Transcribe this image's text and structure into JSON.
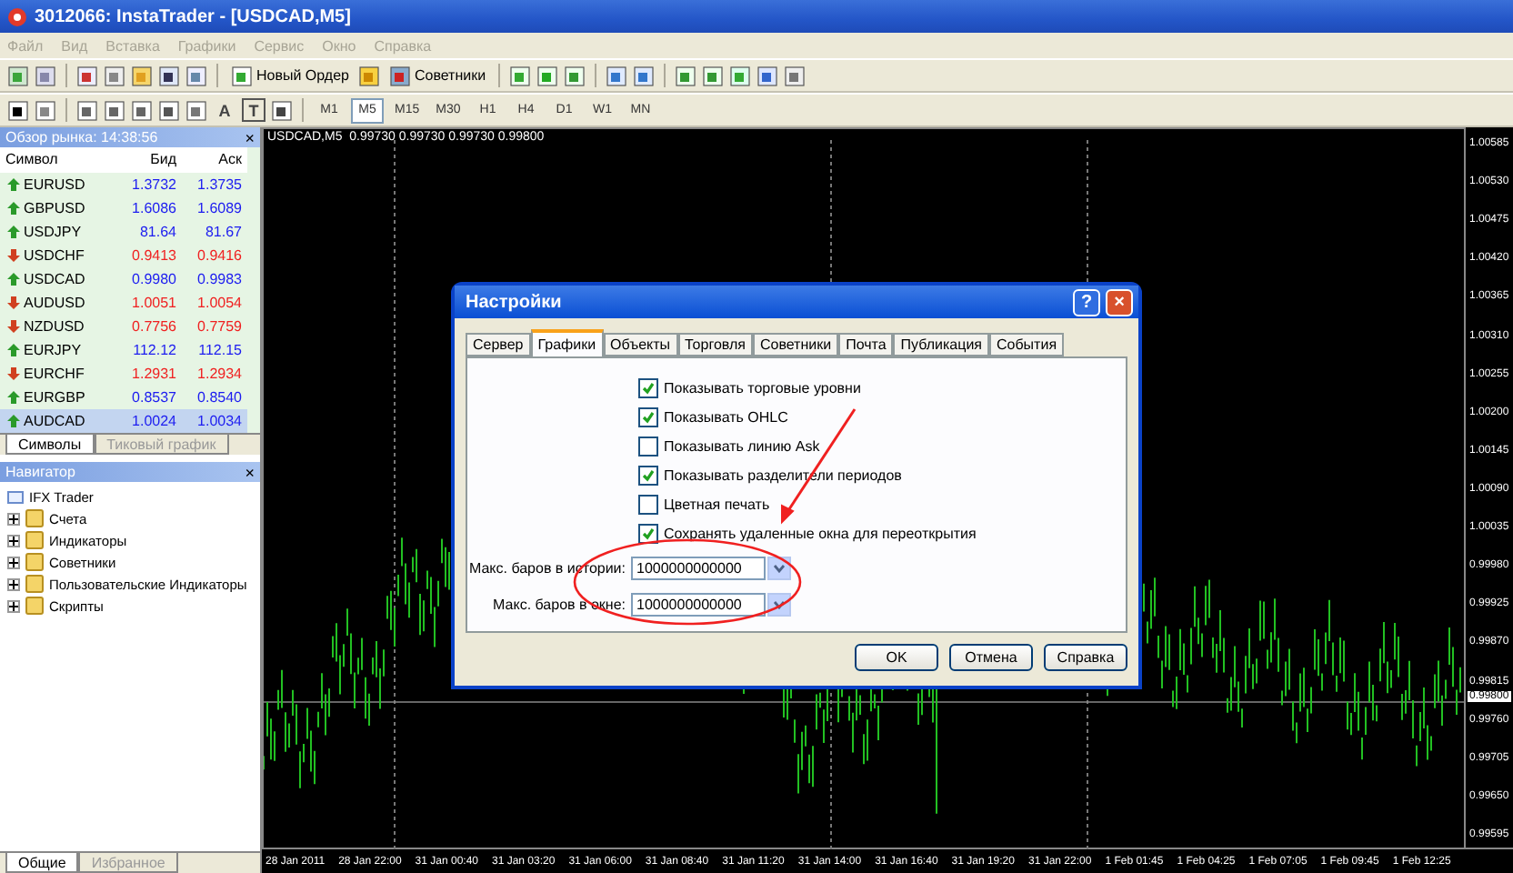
{
  "window": {
    "title": "3012066: InstaTrader - [USDCAD,M5]"
  },
  "menu": [
    {
      "label": "Файл",
      "disabled": true
    },
    {
      "label": "Вид",
      "disabled": true
    },
    {
      "label": "Вставка",
      "disabled": true
    },
    {
      "label": "Графики",
      "disabled": true
    },
    {
      "label": "Сервис",
      "disabled": true
    },
    {
      "label": "Окно",
      "disabled": true
    },
    {
      "label": "Справка",
      "disabled": true
    }
  ],
  "toolbar": {
    "new_order": "Новый Ордер",
    "experts": "Советники",
    "text_tool": "A",
    "label_tool": "T"
  },
  "timeframes": [
    {
      "label": "M1",
      "selected": false
    },
    {
      "label": "M5",
      "selected": true
    },
    {
      "label": "M15",
      "selected": false
    },
    {
      "label": "M30",
      "selected": false
    },
    {
      "label": "H1",
      "selected": false
    },
    {
      "label": "H4",
      "selected": false
    },
    {
      "label": "D1",
      "selected": false
    },
    {
      "label": "W1",
      "selected": false
    },
    {
      "label": "MN",
      "selected": false
    }
  ],
  "market_watch": {
    "title": "Обзор рынка: 14:38:56",
    "close": "×",
    "columns": [
      "Символ",
      "Бид",
      "Аск"
    ],
    "rows": [
      {
        "symbol": "EURUSD",
        "bid": "1.3732",
        "ask": "1.3735",
        "kind": "up",
        "selected": false
      },
      {
        "symbol": "GBPUSD",
        "bid": "1.6086",
        "ask": "1.6089",
        "kind": "up",
        "selected": false
      },
      {
        "symbol": "USDJPY",
        "bid": "81.64",
        "ask": "81.67",
        "kind": "up",
        "selected": false
      },
      {
        "symbol": "USDCHF",
        "bid": "0.9413",
        "ask": "0.9416",
        "kind": "down",
        "selected": false
      },
      {
        "symbol": "USDCAD",
        "bid": "0.9980",
        "ask": "0.9983",
        "kind": "up",
        "selected": false
      },
      {
        "symbol": "AUDUSD",
        "bid": "1.0051",
        "ask": "1.0054",
        "kind": "down",
        "selected": false
      },
      {
        "symbol": "NZDUSD",
        "bid": "0.7756",
        "ask": "0.7759",
        "kind": "down",
        "selected": false
      },
      {
        "symbol": "EURJPY",
        "bid": "112.12",
        "ask": "112.15",
        "kind": "up",
        "selected": false
      },
      {
        "symbol": "EURCHF",
        "bid": "1.2931",
        "ask": "1.2934",
        "kind": "down",
        "selected": false
      },
      {
        "symbol": "EURGBP",
        "bid": "0.8537",
        "ask": "0.8540",
        "kind": "up",
        "selected": false
      },
      {
        "symbol": "AUDCAD",
        "bid": "1.0024",
        "ask": "1.0034",
        "kind": "up",
        "selected": true
      }
    ],
    "tabs": [
      {
        "label": "Символы",
        "selected": true
      },
      {
        "label": "Тиковый график",
        "selected": false
      }
    ]
  },
  "navigator": {
    "title": "Навигатор",
    "close": "×",
    "root": "IFX Trader",
    "items": [
      {
        "label": "Счета",
        "expanded": false
      },
      {
        "label": "Индикаторы",
        "expanded": false
      },
      {
        "label": "Советники",
        "expanded": false
      },
      {
        "label": "Пользовательские Индикаторы",
        "expanded": false
      },
      {
        "label": "Скрипты",
        "expanded": false
      }
    ],
    "tabs": [
      {
        "label": "Общие",
        "selected": true
      },
      {
        "label": "Избранное",
        "selected": false
      }
    ]
  },
  "chart": {
    "header": "USDCAD,M5  0.99730 0.99730 0.99730 0.99800",
    "current_price": "0.99800",
    "price_labels": [
      "1.00585",
      "1.00530",
      "1.00475",
      "1.00420",
      "1.00365",
      "1.00310",
      "1.00255",
      "1.00200",
      "1.00145",
      "1.00090",
      "1.00035",
      "0.99980",
      "0.99925",
      "0.99870",
      "0.99815",
      "0.99760",
      "0.99705",
      "0.99650",
      "0.99595"
    ],
    "time_labels": [
      "28 Jan 2011",
      "28 Jan 22:00",
      "31 Jan 00:40",
      "31 Jan 03:20",
      "31 Jan 06:00",
      "31 Jan 08:40",
      "31 Jan 11:20",
      "31 Jan 14:00",
      "31 Jan 16:40",
      "31 Jan 19:20",
      "31 Jan 22:00",
      "1 Feb 01:45",
      "1 Feb 04:25",
      "1 Feb 07:05",
      "1 Feb 09:45",
      "1 Feb 12:25"
    ]
  },
  "dialog": {
    "title": "Настройки",
    "help": "?",
    "close": "×",
    "tabs": [
      {
        "label": "Сервер",
        "selected": false
      },
      {
        "label": "Графики",
        "selected": true
      },
      {
        "label": "Объекты",
        "selected": false
      },
      {
        "label": "Торговля",
        "selected": false
      },
      {
        "label": "Советники",
        "selected": false
      },
      {
        "label": "Почта",
        "selected": false
      },
      {
        "label": "Публикация",
        "selected": false
      },
      {
        "label": "События",
        "selected": false
      }
    ],
    "checkboxes": [
      {
        "label": "Показывать торговые уровни",
        "checked": true
      },
      {
        "label": "Показывать OHLC",
        "checked": true
      },
      {
        "label": "Показывать линию Ask",
        "checked": false
      },
      {
        "label": "Показывать разделители периодов",
        "checked": true
      },
      {
        "label": "Цветная печать",
        "checked": false
      },
      {
        "label": "Сохранять удаленные окна для переоткрытия",
        "checked": true
      }
    ],
    "fields": [
      {
        "label": "Макс. баров в истории:",
        "value": "1000000000000"
      },
      {
        "label": "Макс. баров в окне:",
        "value": "1000000000000"
      }
    ],
    "buttons": [
      "OK",
      "Отмена",
      "Справка"
    ]
  }
}
